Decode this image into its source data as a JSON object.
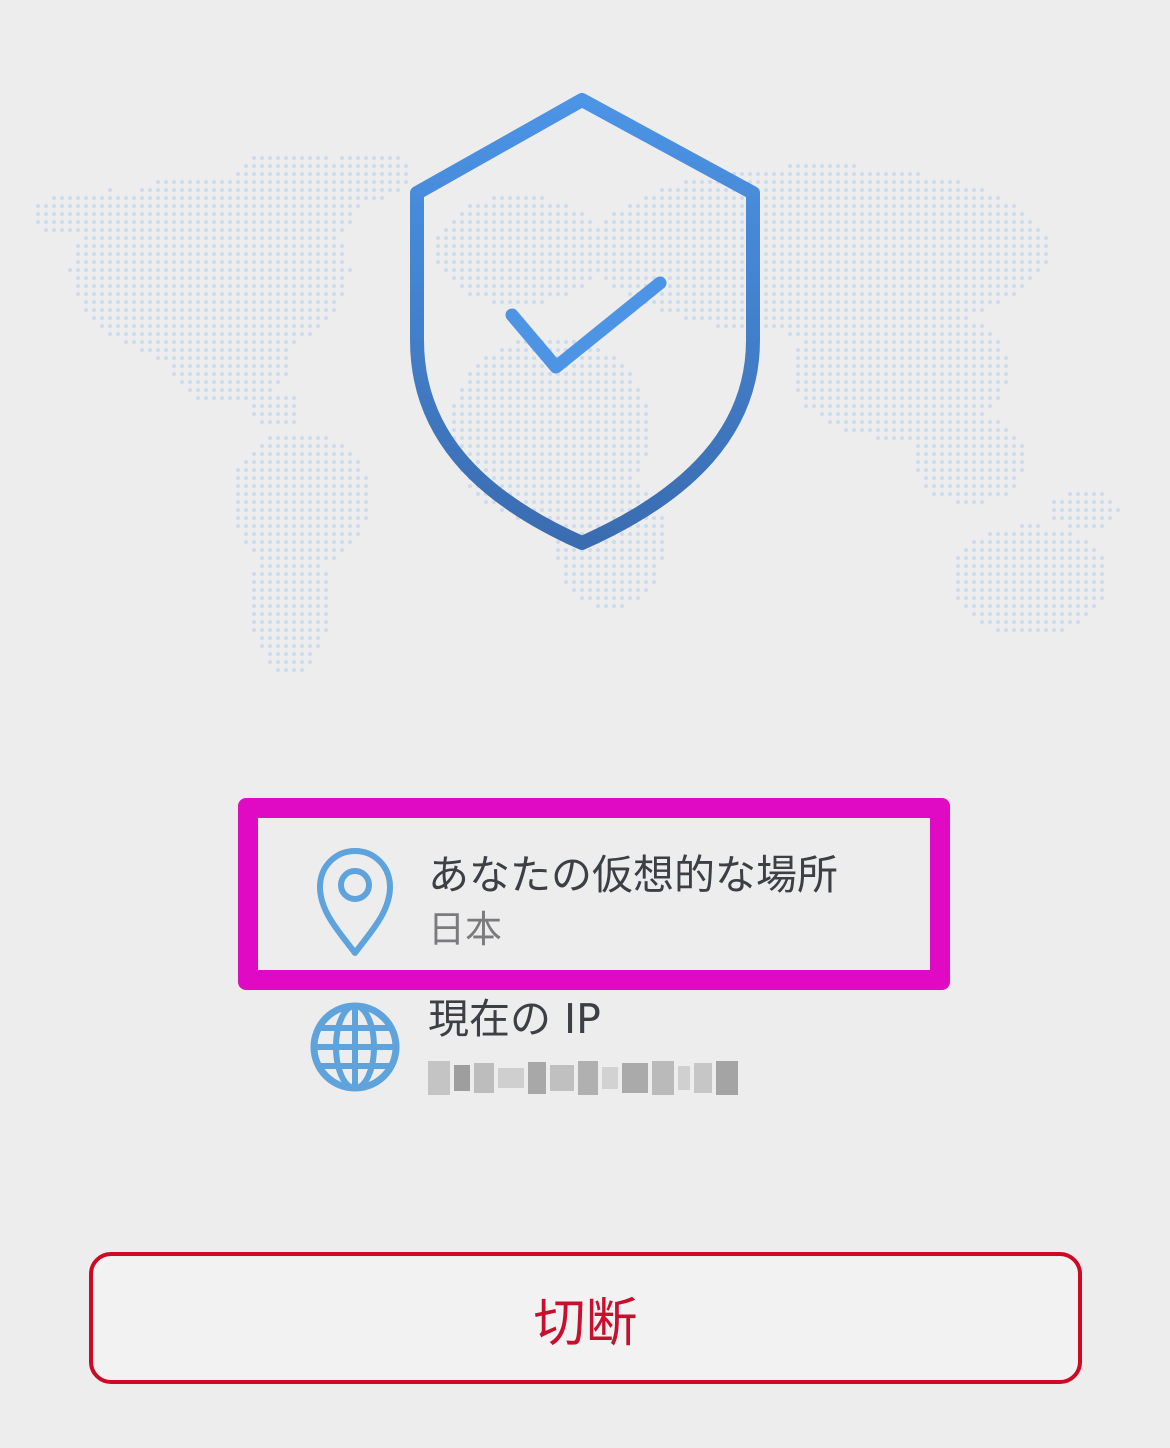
{
  "status": {
    "icon": "shield-check-icon",
    "map": "world-map-dots"
  },
  "location": {
    "icon": "location-pin-icon",
    "label": "あなたの仮想的な場所",
    "value": "日本"
  },
  "ip": {
    "icon": "globe-icon",
    "label": "現在の IP"
  },
  "actions": {
    "disconnect_label": "切断"
  },
  "colors": {
    "background": "#ededee",
    "shield_blue": "#4a8ee0",
    "icon_blue": "#5fa3dc",
    "highlight_magenta": "#e10ac4",
    "disconnect_red": "#cc0a25"
  }
}
